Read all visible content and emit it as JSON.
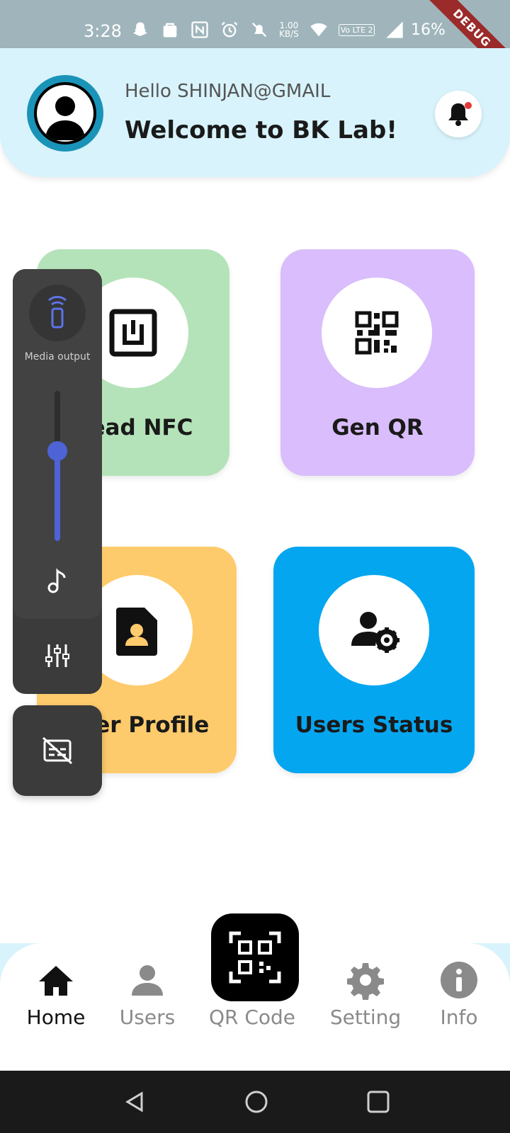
{
  "status_bar": {
    "time": "3:28",
    "net_speed_value": "1.00",
    "net_speed_unit": "KB/S",
    "volte_label": "Vo LTE 2",
    "battery": "16%",
    "debug_banner": "DEBUG",
    "icons": [
      "snapchat-icon",
      "bag-icon",
      "nfc-icon",
      "alarm-icon",
      "mute-icon",
      "wifi-icon",
      "volte-icon",
      "signal-icon",
      "battery-icon"
    ]
  },
  "header": {
    "hello": "Hello SHINJAN@GMAIL",
    "welcome": "Welcome to BK Lab!"
  },
  "tiles": [
    {
      "label": "Read NFC",
      "color": "#b5e3b9",
      "icon": "nfc-chip-icon"
    },
    {
      "label": "Gen QR",
      "color": "#d9bdfc",
      "icon": "qr-code-icon"
    },
    {
      "label": "User Profile",
      "color": "#fecb6c",
      "icon": "profile-card-icon"
    },
    {
      "label": "Users Status",
      "color": "#05a6f0",
      "icon": "user-settings-icon"
    }
  ],
  "media_panel": {
    "label": "Media output",
    "volume_fraction": 0.6,
    "accent": "#4d63d6"
  },
  "bottom_nav": {
    "items": [
      {
        "label": "Home",
        "icon": "home-icon",
        "active": true
      },
      {
        "label": "Users",
        "icon": "user-icon",
        "active": false
      },
      {
        "label": "QR Code",
        "icon": "qr-scan-icon",
        "active": false
      },
      {
        "label": "Setting",
        "icon": "gear-icon",
        "active": false
      },
      {
        "label": "Info",
        "icon": "info-icon",
        "active": false
      }
    ]
  },
  "colors": {
    "header_bg": "#d8f3fb",
    "status_bar_bg": "#9fb5bb"
  }
}
